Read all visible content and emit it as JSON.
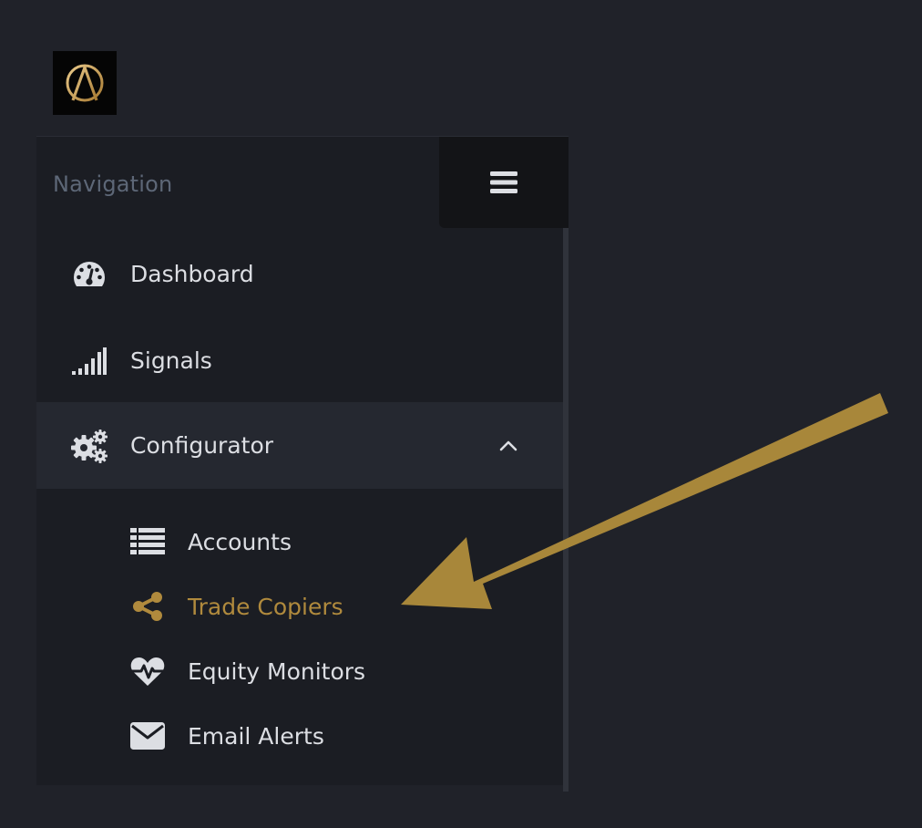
{
  "logo": {
    "letter": "A",
    "color": "#c9a158"
  },
  "sidebar": {
    "nav_title": "Navigation",
    "items": [
      {
        "label": "Dashboard",
        "icon": "dashboard-icon"
      },
      {
        "label": "Signals",
        "icon": "signal-bars-icon"
      },
      {
        "label": "Configurator",
        "icon": "cogs-icon",
        "expanded": true
      }
    ],
    "submenu": [
      {
        "label": "Accounts",
        "icon": "list-icon"
      },
      {
        "label": "Trade Copiers",
        "icon": "share-icon",
        "active": true
      },
      {
        "label": "Equity Monitors",
        "icon": "heartbeat-icon"
      },
      {
        "label": "Email Alerts",
        "icon": "envelope-icon"
      }
    ]
  },
  "colors": {
    "background": "#202229",
    "sidebar": "#1b1d23",
    "accent": "#b08a3d",
    "arrow": "#a8873a",
    "text": "#dcdee3",
    "muted": "#5d6777"
  }
}
